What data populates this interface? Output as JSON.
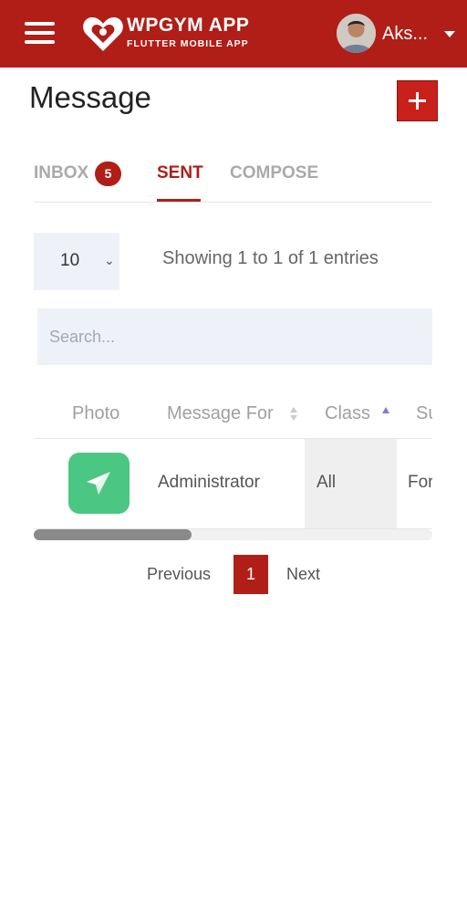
{
  "header": {
    "logo_title": "WPGYM APP",
    "logo_subtitle": "FLUTTER MOBILE APP",
    "user_name": "Aks...",
    "background_color": "#b01e17"
  },
  "page": {
    "title": "Message"
  },
  "tabs": [
    {
      "label": "INBOX",
      "badge": "5",
      "active": false
    },
    {
      "label": "SENT",
      "active": true
    },
    {
      "label": "COMPOSE",
      "active": false
    }
  ],
  "entries": {
    "selected": "10",
    "showing_text": "Showing 1 to 1 of 1 entries"
  },
  "search": {
    "placeholder": "Search...",
    "value": ""
  },
  "table": {
    "columns": [
      "Photo",
      "Message For",
      "Class",
      "Su"
    ],
    "rows": [
      {
        "photo_icon": "paper-plane-icon",
        "message_for": "Administrator",
        "class": "All",
        "subject": "For"
      }
    ]
  },
  "pagination": {
    "previous": "Previous",
    "current": "1",
    "next": "Next"
  },
  "icons": {
    "menu": "hamburger-menu-icon",
    "logo": "heart-logo-icon",
    "add": "plus-icon",
    "dropdown": "caret-down-icon"
  },
  "colors": {
    "accent": "#b01e17",
    "photo_tile": "#4cc783",
    "input_bg": "#eef2f8"
  }
}
